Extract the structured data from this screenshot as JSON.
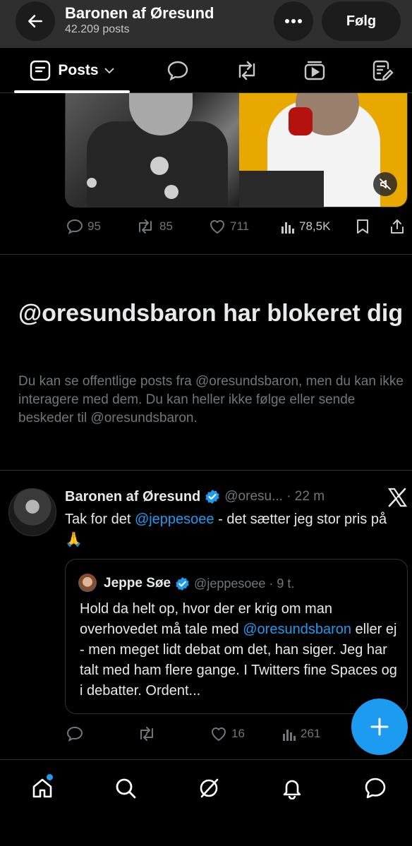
{
  "header": {
    "title": "Baronen af Øresund",
    "post_count": "42.209 posts",
    "follow_label": "Følg"
  },
  "tabs": {
    "posts_label": "Posts"
  },
  "first_post": {
    "replies": "95",
    "reposts": "85",
    "likes": "711",
    "views": "78,5K"
  },
  "blocked": {
    "title": "@oresundsbaron har blokeret dig",
    "text": "Du kan se offentlige posts fra @oresundsbaron, men du kan ikke interagere med dem. Du kan heller ikke følge eller sende beskeder til @oresundsbaron."
  },
  "second_post": {
    "name": "Baronen af Øresund",
    "handle_time": "@oresu... · 22 m",
    "text_before": "Tak for det ",
    "mention": "@jeppesoee",
    "text_after": " - det sætter jeg stor pris på 🙏",
    "replies": "",
    "reposts": "",
    "likes": "16",
    "views": "261"
  },
  "quote": {
    "name": "Jeppe Søe",
    "handle_time": "@jeppesoee · 9 t.",
    "text_before": "Hold da helt op, hvor der er krig om man overhovedet må tale med ",
    "mention": "@oresundsbaron",
    "text_after": " eller ej - men meget lidt debat om det, han siger. Jeg har talt med ham flere gange. I Twitters fine Spaces og i debatter. Ordent..."
  },
  "colors": {
    "accent": "#1d9bf0",
    "muted": "#71767b",
    "background": "#000000",
    "header": "#2f2f2f"
  },
  "icons": {
    "back": "arrow-left-icon",
    "more": "more-icon",
    "posts": "posts-icon",
    "replies_tab": "replies-icon",
    "reposts_tab": "repost-icon",
    "media_tab": "media-icon",
    "articles_tab": "article-icon",
    "nav": [
      "home-icon",
      "search-icon",
      "grok-icon",
      "notifications-icon",
      "messages-icon"
    ]
  }
}
